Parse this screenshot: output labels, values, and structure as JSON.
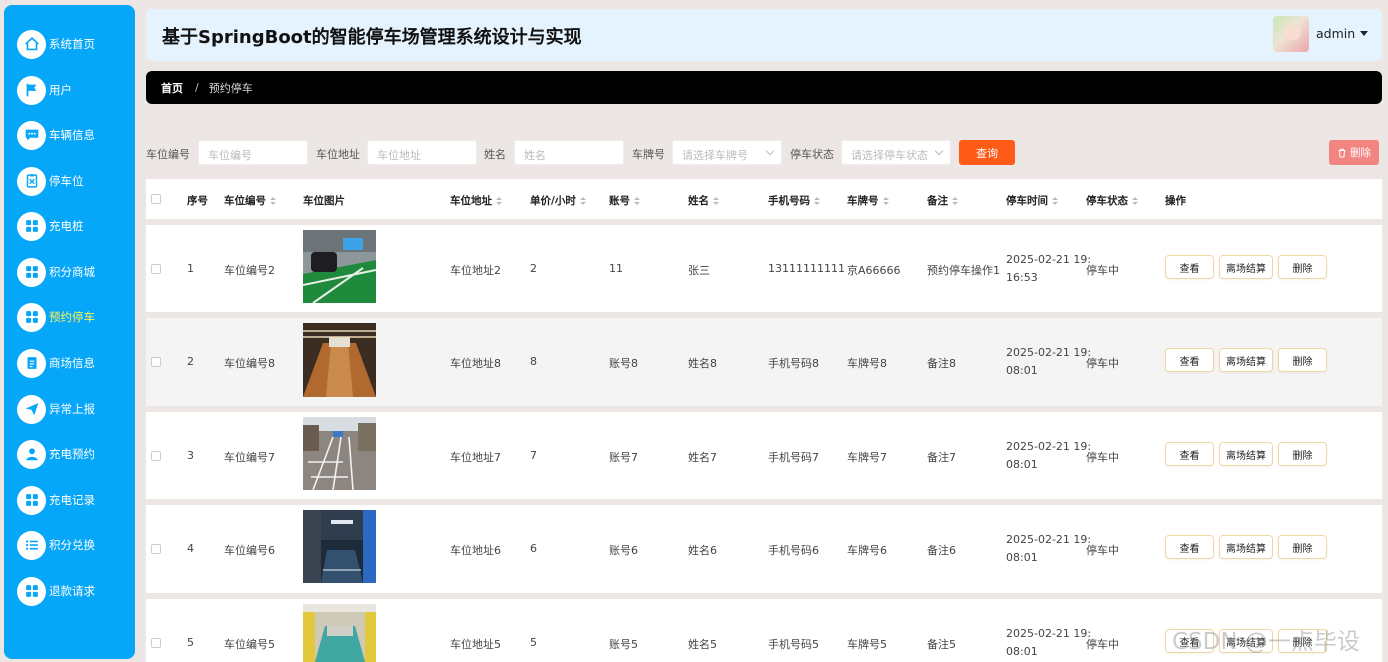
{
  "sidebar": {
    "items": [
      {
        "label": "系统首页",
        "icon": "home-icon"
      },
      {
        "label": "用户",
        "icon": "flag-icon"
      },
      {
        "label": "车辆信息",
        "icon": "chat-icon"
      },
      {
        "label": "停车位",
        "icon": "clipboard-icon"
      },
      {
        "label": "充电桩",
        "icon": "grid-icon"
      },
      {
        "label": "积分商城",
        "icon": "grid-icon"
      },
      {
        "label": "预约停车",
        "icon": "grid-icon",
        "active": true
      },
      {
        "label": "商场信息",
        "icon": "document-icon"
      },
      {
        "label": "异常上报",
        "icon": "send-icon"
      },
      {
        "label": "充电预约",
        "icon": "user-icon"
      },
      {
        "label": "充电记录",
        "icon": "grid-icon"
      },
      {
        "label": "积分兑换",
        "icon": "list-icon"
      },
      {
        "label": "退款请求",
        "icon": "grid-icon"
      }
    ]
  },
  "header": {
    "title": "基于SpringBoot的智能停车场管理系统设计与实现",
    "username": "admin"
  },
  "breadcrumb": {
    "home": "首页",
    "separator": "/",
    "current": "预约停车"
  },
  "search": {
    "space_no_label": "车位编号",
    "space_no_placeholder": "车位编号",
    "address_label": "车位地址",
    "address_placeholder": "车位地址",
    "name_label": "姓名",
    "name_placeholder": "姓名",
    "plate_label": "车牌号",
    "plate_placeholder": "请选择车牌号",
    "status_label": "停车状态",
    "status_placeholder": "请选择停车状态",
    "query_button": "查询",
    "delete_button": "删除"
  },
  "table": {
    "headers": {
      "index": "序号",
      "space_no": "车位编号",
      "image": "车位图片",
      "address": "车位地址",
      "price": "单价/小时",
      "account": "账号",
      "name": "姓名",
      "phone": "手机号码",
      "plate": "车牌号",
      "remark": "备注",
      "time": "停车时间",
      "status": "停车状态",
      "actions": "操作"
    },
    "actions": {
      "view": "查看",
      "settle": "离场结算",
      "delete": "删除"
    },
    "rows": [
      {
        "index": "1",
        "space_no": "车位编号2",
        "image": "parking-photo-1",
        "address": "车位地址2",
        "price": "2",
        "account": "11",
        "name": "张三",
        "phone": "13111111111",
        "plate": "京A66666",
        "remark": "预约停车操作1",
        "time_line1": "2025-02-21 19:",
        "time_line2": "16:53",
        "status": "停车中"
      },
      {
        "index": "2",
        "space_no": "车位编号8",
        "image": "parking-photo-2",
        "address": "车位地址8",
        "price": "8",
        "account": "账号8",
        "name": "姓名8",
        "phone": "手机号码8",
        "plate": "车牌号8",
        "remark": "备注8",
        "time_line1": "2025-02-21 19:",
        "time_line2": "08:01",
        "status": "停车中"
      },
      {
        "index": "3",
        "space_no": "车位编号7",
        "image": "parking-photo-3",
        "address": "车位地址7",
        "price": "7",
        "account": "账号7",
        "name": "姓名7",
        "phone": "手机号码7",
        "plate": "车牌号7",
        "remark": "备注7",
        "time_line1": "2025-02-21 19:",
        "time_line2": "08:01",
        "status": "停车中"
      },
      {
        "index": "4",
        "space_no": "车位编号6",
        "image": "parking-photo-4",
        "address": "车位地址6",
        "price": "6",
        "account": "账号6",
        "name": "姓名6",
        "phone": "手机号码6",
        "plate": "车牌号6",
        "remark": "备注6",
        "time_line1": "2025-02-21 19:",
        "time_line2": "08:01",
        "status": "停车中"
      },
      {
        "index": "5",
        "space_no": "车位编号5",
        "image": "parking-photo-5",
        "address": "车位地址5",
        "price": "5",
        "account": "账号5",
        "name": "姓名5",
        "phone": "手机号码5",
        "plate": "车牌号5",
        "remark": "备注5",
        "time_line1": "2025-02-21 19:",
        "time_line2": "08:01",
        "status": "停车中"
      }
    ]
  },
  "watermark": "CSDN @一点毕设",
  "colors": {
    "sidebar": "#06a6f8",
    "active_nav_text": "#fff25a",
    "header_bg": "#e4f3fd",
    "breadcrumb_bg": "#000000",
    "query_button": "#ff5b18",
    "delete_button": "#f28481"
  }
}
